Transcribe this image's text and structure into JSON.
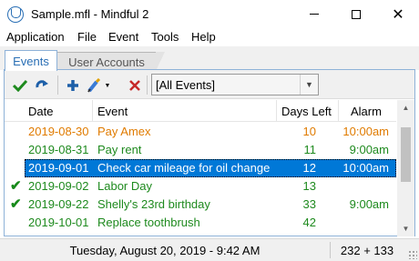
{
  "window": {
    "title": "Sample.mfl - Mindful 2",
    "icon": "mindful-logo-icon"
  },
  "menu": [
    {
      "label": "Application"
    },
    {
      "label": "File"
    },
    {
      "label": "Event"
    },
    {
      "label": "Tools"
    },
    {
      "label": "Help"
    }
  ],
  "tabs": [
    {
      "label": "Events",
      "active": true
    },
    {
      "label": "User Accounts",
      "active": false
    }
  ],
  "toolbar": {
    "buttons": [
      "check-icon",
      "refresh-icon",
      "add-icon",
      "edit-icon",
      "delete-icon"
    ],
    "filter": {
      "selected": "[All Events]"
    }
  },
  "table": {
    "columns": [
      "Date",
      "Event",
      "Days Left",
      "Alarm"
    ],
    "rows": [
      {
        "date": "2019-08-30",
        "event": "Pay Amex",
        "days_left": "10",
        "alarm": "10:00am",
        "color": "#e07b00",
        "checked": false,
        "selected": false
      },
      {
        "date": "2019-08-31",
        "event": "Pay rent",
        "days_left": "11",
        "alarm": "9:00am",
        "color": "#1e8a1e",
        "checked": false,
        "selected": false
      },
      {
        "date": "2019-09-01",
        "event": "Check car mileage for oil change",
        "days_left": "12",
        "alarm": "10:00am",
        "color": "#ffffff",
        "checked": false,
        "selected": true
      },
      {
        "date": "2019-09-02",
        "event": "Labor Day",
        "days_left": "13",
        "alarm": "",
        "color": "#1e8a1e",
        "checked": true,
        "selected": false
      },
      {
        "date": "2019-09-22",
        "event": "Shelly's 23rd birthday",
        "days_left": "33",
        "alarm": "9:00am",
        "color": "#1e8a1e",
        "checked": true,
        "selected": false
      },
      {
        "date": "2019-10-01",
        "event": "Replace toothbrush",
        "days_left": "42",
        "alarm": "",
        "color": "#1e8a1e",
        "checked": false,
        "selected": false
      }
    ]
  },
  "status": {
    "datetime": "Tuesday, August 20, 2019 - 9:42 AM",
    "count": "232 + 133"
  },
  "colors": {
    "accent": "#0078d7",
    "upcoming": "#e07b00",
    "normal": "#1e8a1e"
  }
}
